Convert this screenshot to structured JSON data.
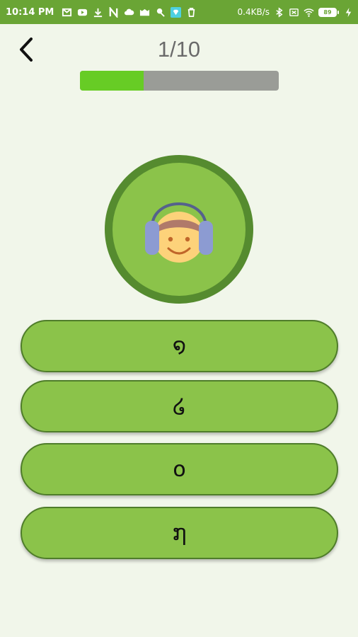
{
  "status_bar": {
    "time": "10:14 PM",
    "net_speed": "0.4KB/s",
    "battery": "89",
    "icons": [
      "gmail-icon",
      "youtube-icon",
      "download-icon",
      "n-icon",
      "cloud-icon",
      "lmao-icon",
      "pin-icon",
      "diamond-icon",
      "trash-icon",
      "bluetooth-icon",
      "sim-off-icon",
      "wifi-icon",
      "battery-icon",
      "charging-icon"
    ]
  },
  "header": {
    "counter": "1/10",
    "progress": 0.32
  },
  "colors": {
    "status_bar": "#6aa535",
    "background": "#f1f6ea",
    "progress_fill": "#67cc25",
    "progress_track": "#9a9c97",
    "button": "#8bc34a",
    "button_border": "#4f7d2a",
    "circle_ring": "#558b2f"
  },
  "options": [
    {
      "label": "໑"
    },
    {
      "label": "໒"
    },
    {
      "label": "໐"
    },
    {
      "label": "໗"
    }
  ]
}
